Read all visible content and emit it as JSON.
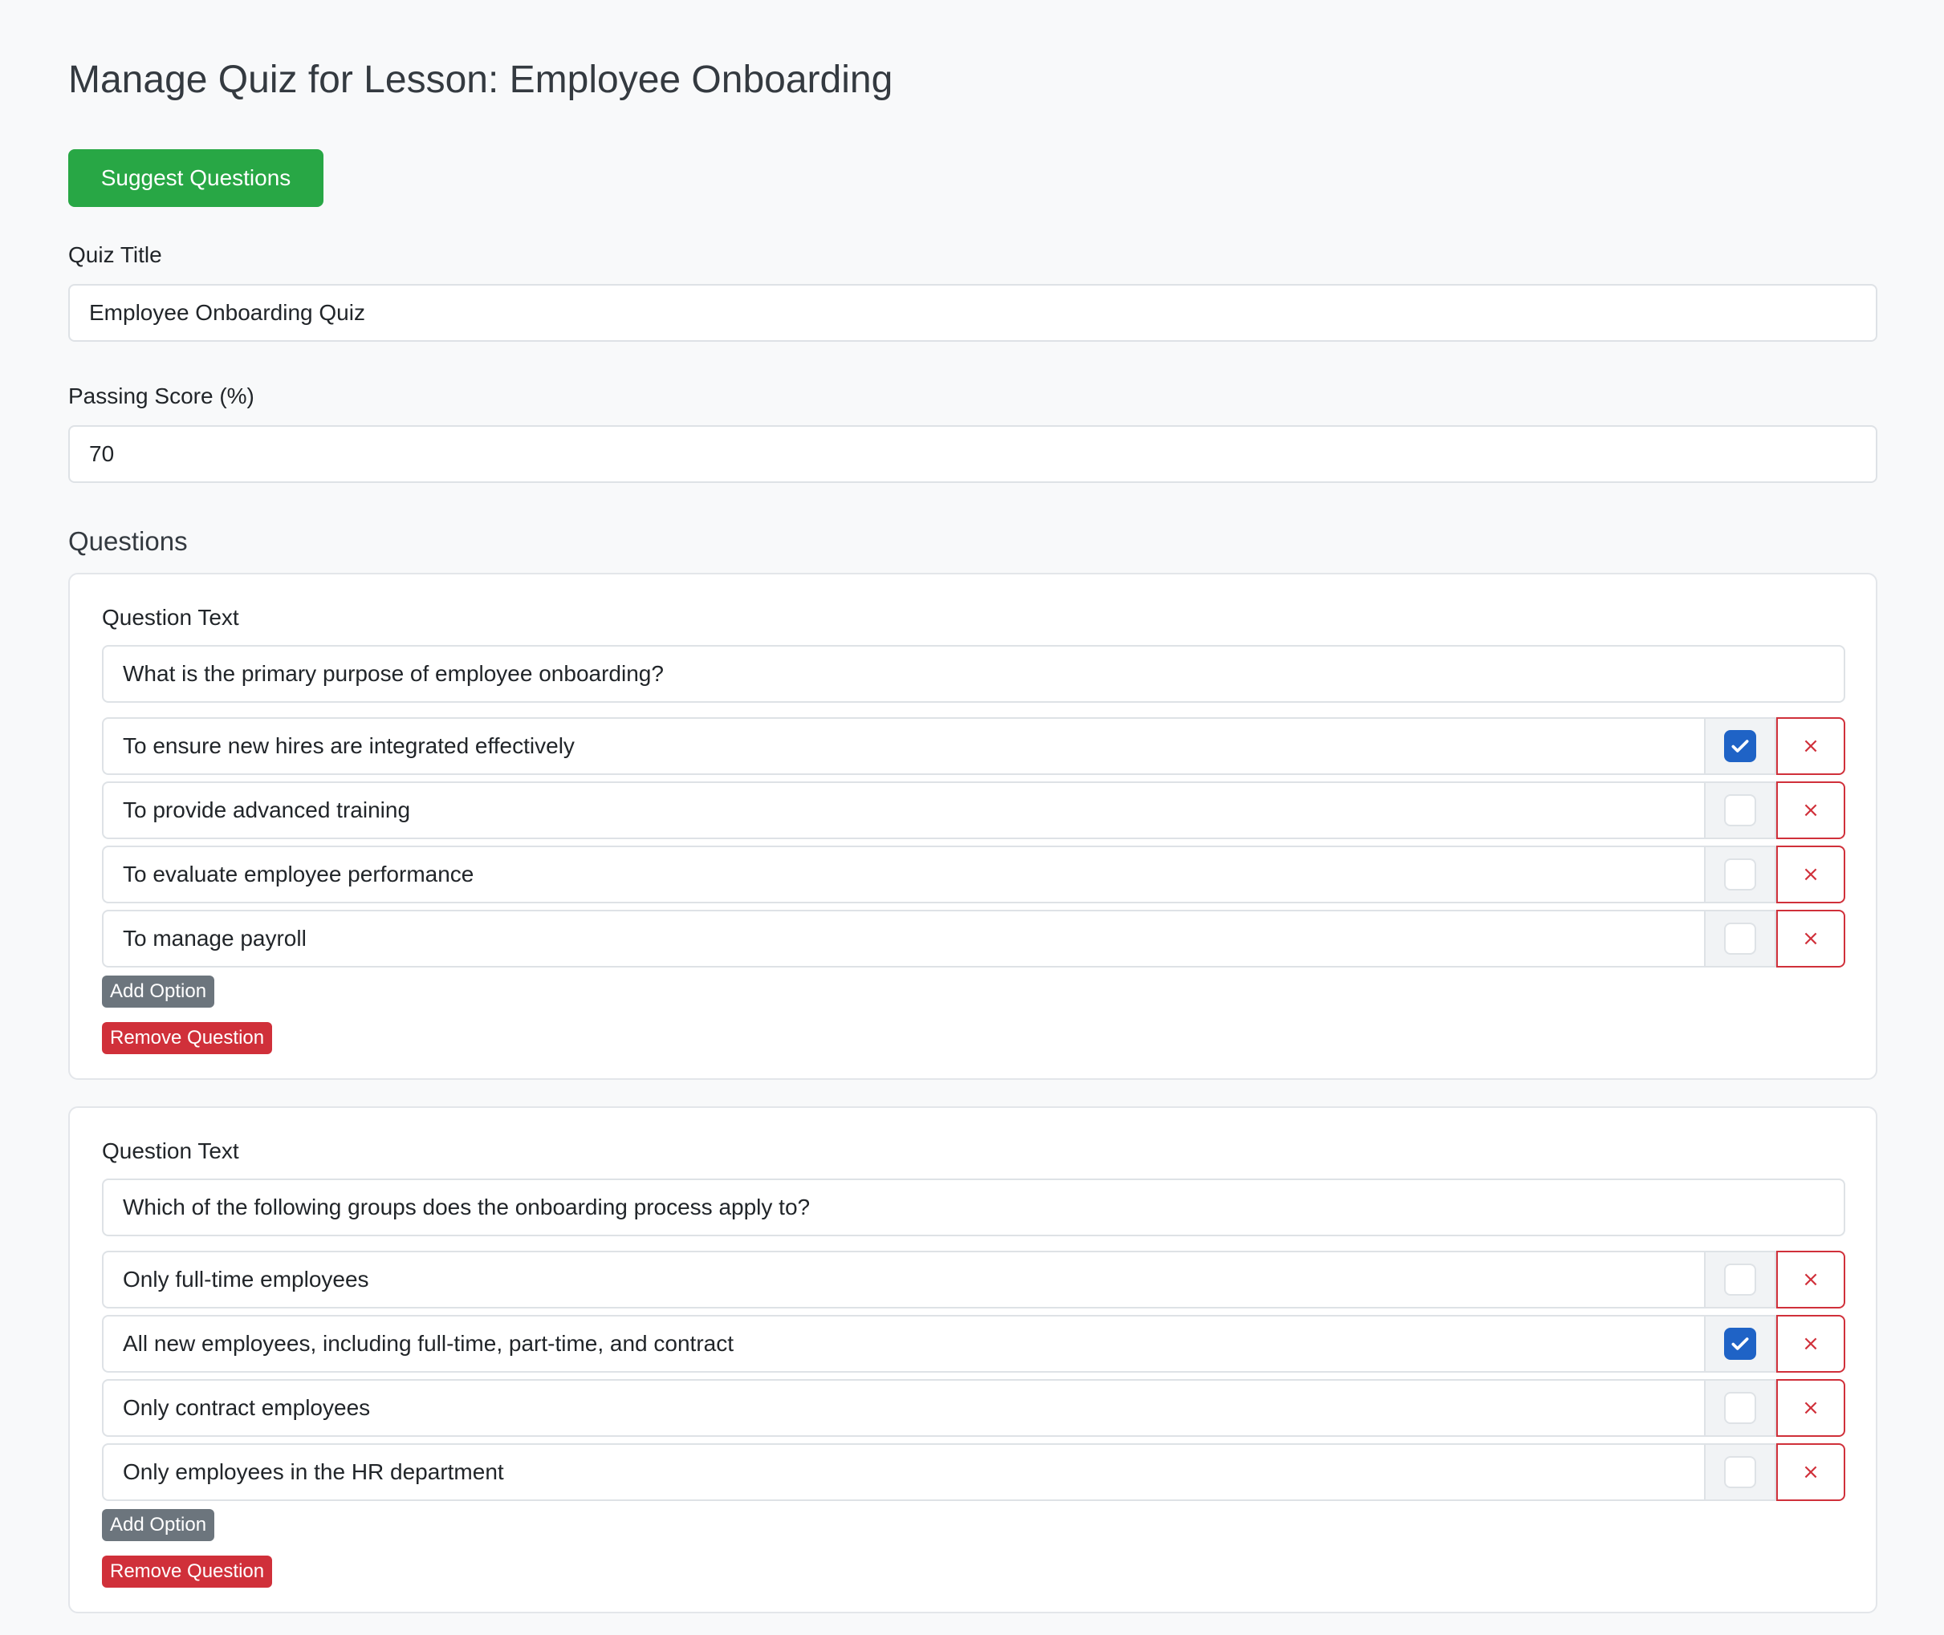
{
  "page": {
    "title": "Manage Quiz for Lesson: Employee Onboarding",
    "suggest_button_label": "Suggest Questions",
    "background_color": "#f8f9fa",
    "accent_success": "#28a745",
    "accent_danger": "#d0303a",
    "accent_primary": "#1f63c6"
  },
  "quiz": {
    "title_label": "Quiz Title",
    "title_value": "Employee Onboarding Quiz",
    "passing_label": "Passing Score (%)",
    "passing_value": "70"
  },
  "questions_section": {
    "heading": "Questions",
    "question_label": "Question Text",
    "add_option_label": "Add Option",
    "remove_question_label": "Remove Question",
    "remove_option_symbol": "×",
    "check_icon": "check-icon",
    "questions": [
      {
        "text": "What is the primary purpose of employee onboarding?",
        "options": [
          {
            "text": "To ensure new hires are integrated effectively",
            "correct": true
          },
          {
            "text": "To provide advanced training",
            "correct": false
          },
          {
            "text": "To evaluate employee performance",
            "correct": false
          },
          {
            "text": "To manage payroll",
            "correct": false
          }
        ]
      },
      {
        "text": "Which of the following groups does the onboarding process apply to?",
        "options": [
          {
            "text": "Only full-time employees",
            "correct": false
          },
          {
            "text": "All new employees, including full-time, part-time, and contract",
            "correct": true
          },
          {
            "text": "Only contract employees",
            "correct": false
          },
          {
            "text": "Only employees in the HR department",
            "correct": false
          }
        ]
      }
    ]
  }
}
